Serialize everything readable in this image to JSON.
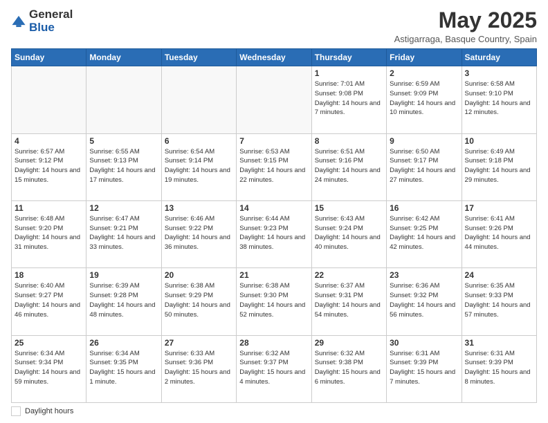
{
  "logo": {
    "general": "General",
    "blue": "Blue"
  },
  "title": "May 2025",
  "subtitle": "Astigarraga, Basque Country, Spain",
  "days_of_week": [
    "Sunday",
    "Monday",
    "Tuesday",
    "Wednesday",
    "Thursday",
    "Friday",
    "Saturday"
  ],
  "footer": {
    "daylight_label": "Daylight hours"
  },
  "weeks": [
    [
      {
        "day": "",
        "info": ""
      },
      {
        "day": "",
        "info": ""
      },
      {
        "day": "",
        "info": ""
      },
      {
        "day": "",
        "info": ""
      },
      {
        "day": "1",
        "info": "Sunrise: 7:01 AM\nSunset: 9:08 PM\nDaylight: 14 hours\nand 7 minutes."
      },
      {
        "day": "2",
        "info": "Sunrise: 6:59 AM\nSunset: 9:09 PM\nDaylight: 14 hours\nand 10 minutes."
      },
      {
        "day": "3",
        "info": "Sunrise: 6:58 AM\nSunset: 9:10 PM\nDaylight: 14 hours\nand 12 minutes."
      }
    ],
    [
      {
        "day": "4",
        "info": "Sunrise: 6:57 AM\nSunset: 9:12 PM\nDaylight: 14 hours\nand 15 minutes."
      },
      {
        "day": "5",
        "info": "Sunrise: 6:55 AM\nSunset: 9:13 PM\nDaylight: 14 hours\nand 17 minutes."
      },
      {
        "day": "6",
        "info": "Sunrise: 6:54 AM\nSunset: 9:14 PM\nDaylight: 14 hours\nand 19 minutes."
      },
      {
        "day": "7",
        "info": "Sunrise: 6:53 AM\nSunset: 9:15 PM\nDaylight: 14 hours\nand 22 minutes."
      },
      {
        "day": "8",
        "info": "Sunrise: 6:51 AM\nSunset: 9:16 PM\nDaylight: 14 hours\nand 24 minutes."
      },
      {
        "day": "9",
        "info": "Sunrise: 6:50 AM\nSunset: 9:17 PM\nDaylight: 14 hours\nand 27 minutes."
      },
      {
        "day": "10",
        "info": "Sunrise: 6:49 AM\nSunset: 9:18 PM\nDaylight: 14 hours\nand 29 minutes."
      }
    ],
    [
      {
        "day": "11",
        "info": "Sunrise: 6:48 AM\nSunset: 9:20 PM\nDaylight: 14 hours\nand 31 minutes."
      },
      {
        "day": "12",
        "info": "Sunrise: 6:47 AM\nSunset: 9:21 PM\nDaylight: 14 hours\nand 33 minutes."
      },
      {
        "day": "13",
        "info": "Sunrise: 6:46 AM\nSunset: 9:22 PM\nDaylight: 14 hours\nand 36 minutes."
      },
      {
        "day": "14",
        "info": "Sunrise: 6:44 AM\nSunset: 9:23 PM\nDaylight: 14 hours\nand 38 minutes."
      },
      {
        "day": "15",
        "info": "Sunrise: 6:43 AM\nSunset: 9:24 PM\nDaylight: 14 hours\nand 40 minutes."
      },
      {
        "day": "16",
        "info": "Sunrise: 6:42 AM\nSunset: 9:25 PM\nDaylight: 14 hours\nand 42 minutes."
      },
      {
        "day": "17",
        "info": "Sunrise: 6:41 AM\nSunset: 9:26 PM\nDaylight: 14 hours\nand 44 minutes."
      }
    ],
    [
      {
        "day": "18",
        "info": "Sunrise: 6:40 AM\nSunset: 9:27 PM\nDaylight: 14 hours\nand 46 minutes."
      },
      {
        "day": "19",
        "info": "Sunrise: 6:39 AM\nSunset: 9:28 PM\nDaylight: 14 hours\nand 48 minutes."
      },
      {
        "day": "20",
        "info": "Sunrise: 6:38 AM\nSunset: 9:29 PM\nDaylight: 14 hours\nand 50 minutes."
      },
      {
        "day": "21",
        "info": "Sunrise: 6:38 AM\nSunset: 9:30 PM\nDaylight: 14 hours\nand 52 minutes."
      },
      {
        "day": "22",
        "info": "Sunrise: 6:37 AM\nSunset: 9:31 PM\nDaylight: 14 hours\nand 54 minutes."
      },
      {
        "day": "23",
        "info": "Sunrise: 6:36 AM\nSunset: 9:32 PM\nDaylight: 14 hours\nand 56 minutes."
      },
      {
        "day": "24",
        "info": "Sunrise: 6:35 AM\nSunset: 9:33 PM\nDaylight: 14 hours\nand 57 minutes."
      }
    ],
    [
      {
        "day": "25",
        "info": "Sunrise: 6:34 AM\nSunset: 9:34 PM\nDaylight: 14 hours\nand 59 minutes."
      },
      {
        "day": "26",
        "info": "Sunrise: 6:34 AM\nSunset: 9:35 PM\nDaylight: 15 hours\nand 1 minute."
      },
      {
        "day": "27",
        "info": "Sunrise: 6:33 AM\nSunset: 9:36 PM\nDaylight: 15 hours\nand 2 minutes."
      },
      {
        "day": "28",
        "info": "Sunrise: 6:32 AM\nSunset: 9:37 PM\nDaylight: 15 hours\nand 4 minutes."
      },
      {
        "day": "29",
        "info": "Sunrise: 6:32 AM\nSunset: 9:38 PM\nDaylight: 15 hours\nand 6 minutes."
      },
      {
        "day": "30",
        "info": "Sunrise: 6:31 AM\nSunset: 9:39 PM\nDaylight: 15 hours\nand 7 minutes."
      },
      {
        "day": "31",
        "info": "Sunrise: 6:31 AM\nSunset: 9:39 PM\nDaylight: 15 hours\nand 8 minutes."
      }
    ]
  ]
}
